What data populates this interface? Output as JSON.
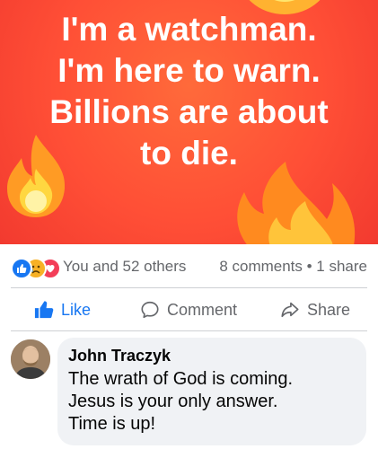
{
  "post": {
    "banner_lines": [
      "I'm a watchman.",
      "I'm here to warn.",
      "Billions are about",
      "to die."
    ],
    "banner_color": "#ff4f36"
  },
  "stats": {
    "reactions": [
      "like-icon",
      "sad-face-icon",
      "love-icon"
    ],
    "reaction_summary": "You and 52 others",
    "comments_shares": "8 comments • 1 share"
  },
  "actions": {
    "like_label": "Like",
    "comment_label": "Comment",
    "share_label": "Share",
    "like_color": "#1877f2"
  },
  "comment": {
    "author": "John Traczyk",
    "lines": [
      "The wrath of God is coming.",
      "Jesus is your only answer.",
      "Time is up!"
    ]
  }
}
